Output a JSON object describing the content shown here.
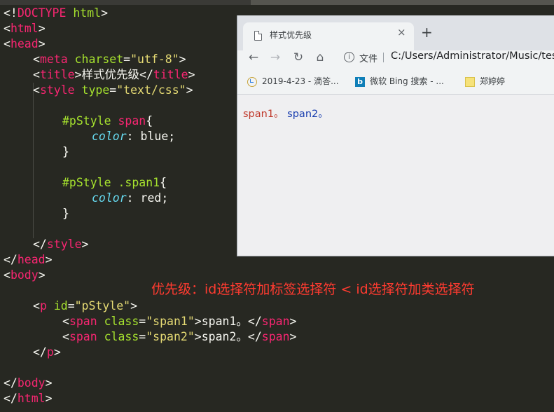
{
  "editor": {
    "lines": [
      {
        "tokens": [
          {
            "c": "w",
            "v": "<!"
          },
          {
            "c": "t",
            "v": "DOCTYPE"
          },
          {
            "c": "w",
            "v": " "
          },
          {
            "c": "a",
            "v": "html"
          },
          {
            "c": "w",
            "v": ">"
          }
        ]
      },
      {
        "tokens": [
          {
            "c": "w",
            "v": "<"
          },
          {
            "c": "t",
            "v": "html"
          },
          {
            "c": "w",
            "v": ">"
          }
        ]
      },
      {
        "tokens": [
          {
            "c": "w",
            "v": "<"
          },
          {
            "c": "t",
            "v": "head"
          },
          {
            "c": "w",
            "v": ">"
          }
        ]
      },
      {
        "indent": 1,
        "tokens": [
          {
            "c": "w",
            "v": "<"
          },
          {
            "c": "t",
            "v": "meta"
          },
          {
            "c": "w",
            "v": " "
          },
          {
            "c": "a",
            "v": "charset"
          },
          {
            "c": "w",
            "v": "="
          },
          {
            "c": "s",
            "v": "\"utf-8\""
          },
          {
            "c": "w",
            "v": ">"
          }
        ]
      },
      {
        "indent": 1,
        "tokens": [
          {
            "c": "w",
            "v": "<"
          },
          {
            "c": "t",
            "v": "title"
          },
          {
            "c": "w",
            "v": ">样式优先级</"
          },
          {
            "c": "t",
            "v": "title"
          },
          {
            "c": "w",
            "v": ">"
          }
        ]
      },
      {
        "indent": 1,
        "tokens": [
          {
            "c": "w",
            "v": "<"
          },
          {
            "c": "t",
            "v": "style"
          },
          {
            "c": "w",
            "v": " "
          },
          {
            "c": "a",
            "v": "type"
          },
          {
            "c": "w",
            "v": "="
          },
          {
            "c": "s",
            "v": "\"text/css\""
          },
          {
            "c": "w",
            "v": ">"
          }
        ]
      },
      {
        "tokens": []
      },
      {
        "indent": 2,
        "tokens": [
          {
            "c": "a",
            "v": "#pStyle"
          },
          {
            "c": "w",
            "v": " "
          },
          {
            "c": "t",
            "v": "span"
          },
          {
            "c": "w",
            "v": "{"
          }
        ]
      },
      {
        "indent": 3,
        "tokens": [
          {
            "c": "p",
            "v": "color"
          },
          {
            "c": "w",
            "v": ": blue;"
          }
        ]
      },
      {
        "indent": 2,
        "tokens": [
          {
            "c": "w",
            "v": "}"
          }
        ]
      },
      {
        "tokens": []
      },
      {
        "indent": 2,
        "tokens": [
          {
            "c": "a",
            "v": "#pStyle"
          },
          {
            "c": "w",
            "v": " "
          },
          {
            "c": "a",
            "v": ".span1"
          },
          {
            "c": "w",
            "v": "{"
          }
        ]
      },
      {
        "indent": 3,
        "tokens": [
          {
            "c": "p",
            "v": "color"
          },
          {
            "c": "w",
            "v": ": red;"
          }
        ]
      },
      {
        "indent": 2,
        "tokens": [
          {
            "c": "w",
            "v": "}"
          }
        ]
      },
      {
        "tokens": []
      },
      {
        "indent": 1,
        "tokens": [
          {
            "c": "w",
            "v": "</"
          },
          {
            "c": "t",
            "v": "style"
          },
          {
            "c": "w",
            "v": ">"
          }
        ]
      },
      {
        "tokens": [
          {
            "c": "w",
            "v": "</"
          },
          {
            "c": "t",
            "v": "head"
          },
          {
            "c": "w",
            "v": ">"
          }
        ]
      },
      {
        "tokens": [
          {
            "c": "w",
            "v": "<"
          },
          {
            "c": "t",
            "v": "body"
          },
          {
            "c": "w",
            "v": ">"
          }
        ]
      },
      {
        "tokens": []
      },
      {
        "indent": 1,
        "tokens": [
          {
            "c": "w",
            "v": "<"
          },
          {
            "c": "t",
            "v": "p"
          },
          {
            "c": "w",
            "v": " "
          },
          {
            "c": "a",
            "v": "id"
          },
          {
            "c": "w",
            "v": "="
          },
          {
            "c": "s",
            "v": "\"pStyle\""
          },
          {
            "c": "w",
            "v": ">"
          }
        ]
      },
      {
        "indent": 2,
        "tokens": [
          {
            "c": "w",
            "v": "<"
          },
          {
            "c": "t",
            "v": "span"
          },
          {
            "c": "w",
            "v": " "
          },
          {
            "c": "a",
            "v": "class"
          },
          {
            "c": "w",
            "v": "="
          },
          {
            "c": "s",
            "v": "\"span1\""
          },
          {
            "c": "w",
            "v": ">span1。</"
          },
          {
            "c": "t",
            "v": "span"
          },
          {
            "c": "w",
            "v": ">"
          }
        ]
      },
      {
        "indent": 2,
        "tokens": [
          {
            "c": "w",
            "v": "<"
          },
          {
            "c": "t",
            "v": "span"
          },
          {
            "c": "w",
            "v": " "
          },
          {
            "c": "a",
            "v": "class"
          },
          {
            "c": "w",
            "v": "="
          },
          {
            "c": "s",
            "v": "\"span2\""
          },
          {
            "c": "w",
            "v": ">span2。</"
          },
          {
            "c": "t",
            "v": "span"
          },
          {
            "c": "w",
            "v": ">"
          }
        ]
      },
      {
        "indent": 1,
        "tokens": [
          {
            "c": "w",
            "v": "</"
          },
          {
            "c": "t",
            "v": "p"
          },
          {
            "c": "w",
            "v": ">"
          }
        ]
      },
      {
        "tokens": []
      },
      {
        "tokens": [
          {
            "c": "w",
            "v": "</"
          },
          {
            "c": "t",
            "v": "body"
          },
          {
            "c": "w",
            "v": ">"
          }
        ]
      },
      {
        "tokens": [
          {
            "c": "w",
            "v": "</"
          },
          {
            "c": "t",
            "v": "html"
          },
          {
            "c": "w",
            "v": ">"
          }
        ]
      }
    ]
  },
  "annotation": "优先级：id选择符加标签选择符 < id选择符加类选择符",
  "browser": {
    "tab_title": "样式优先级",
    "tab_close": "×",
    "new_tab": "+",
    "nav": {
      "back": "←",
      "forward": "→",
      "reload": "↻",
      "home": "⌂",
      "info": "i"
    },
    "file_label": "文件",
    "url": "C:/Users/Administrator/Music/test.",
    "bookmarks": [
      {
        "label": "2019-4-23 - 滴答...",
        "icon": "clock-check-icon"
      },
      {
        "label": "微软 Bing 搜索 - ...",
        "icon": "bing-icon"
      },
      {
        "label": "郑婷婷",
        "icon": "folder-icon"
      }
    ],
    "page": {
      "span1": "span1。",
      "span2": "span2。"
    }
  },
  "colors": {
    "editor_bg": "#272822",
    "tag": "#f92672",
    "attr": "#a6e22e",
    "string": "#e6db74",
    "property": "#66d9ef",
    "annotation": "#ff3b30",
    "span1_text": "#c0392b",
    "span2_text": "#1a3fb0"
  }
}
